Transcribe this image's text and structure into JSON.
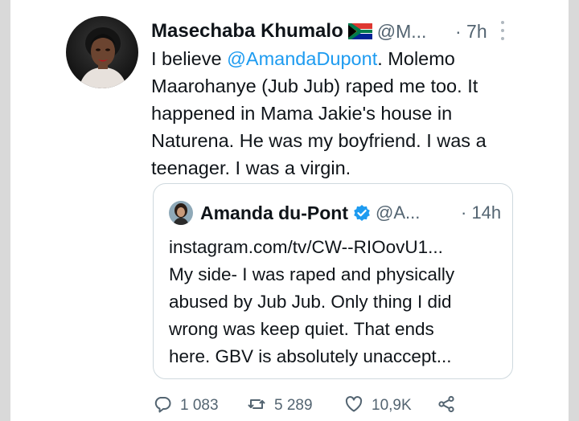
{
  "tweet": {
    "author": {
      "name": "Masechaba Khumalo",
      "flag_icon": "south-africa-flag-icon",
      "handle": "@M..."
    },
    "time": "· 7h",
    "body": {
      "line1_prefix": "I believe ",
      "mention": "@AmandaDupont",
      "line1_suffix": ". Molemo",
      "line2": "Maarohanye (Jub Jub) raped me too. It",
      "line3": "happened in Mama Jakie's house in",
      "line4": "Naturena. He was my boyfriend. I was a",
      "line5": "teenager. I was a virgin."
    }
  },
  "quoted_tweet": {
    "author": {
      "name": "Amanda du-Pont",
      "verified_icon": "verified-badge-icon",
      "handle": "@A..."
    },
    "time": "· 14h",
    "lines": [
      "instagram.com/tv/CW--RIOovU1...",
      "My side- I was raped and physically",
      "abused by Jub Jub. Only thing I did",
      "wrong was keep quiet. That ends",
      "here. GBV is absolutely unaccept..."
    ]
  },
  "actions": {
    "reply": {
      "icon": "reply-icon",
      "count": "1 083"
    },
    "retweet": {
      "icon": "retweet-icon",
      "count": "5 289"
    },
    "like": {
      "icon": "heart-icon",
      "count": "10,9K"
    },
    "share": {
      "icon": "share-icon"
    }
  },
  "colors": {
    "link": "#1d9bf0",
    "secondary_text": "#536471",
    "primary_text": "#0f1419",
    "border": "#cfd9de"
  }
}
